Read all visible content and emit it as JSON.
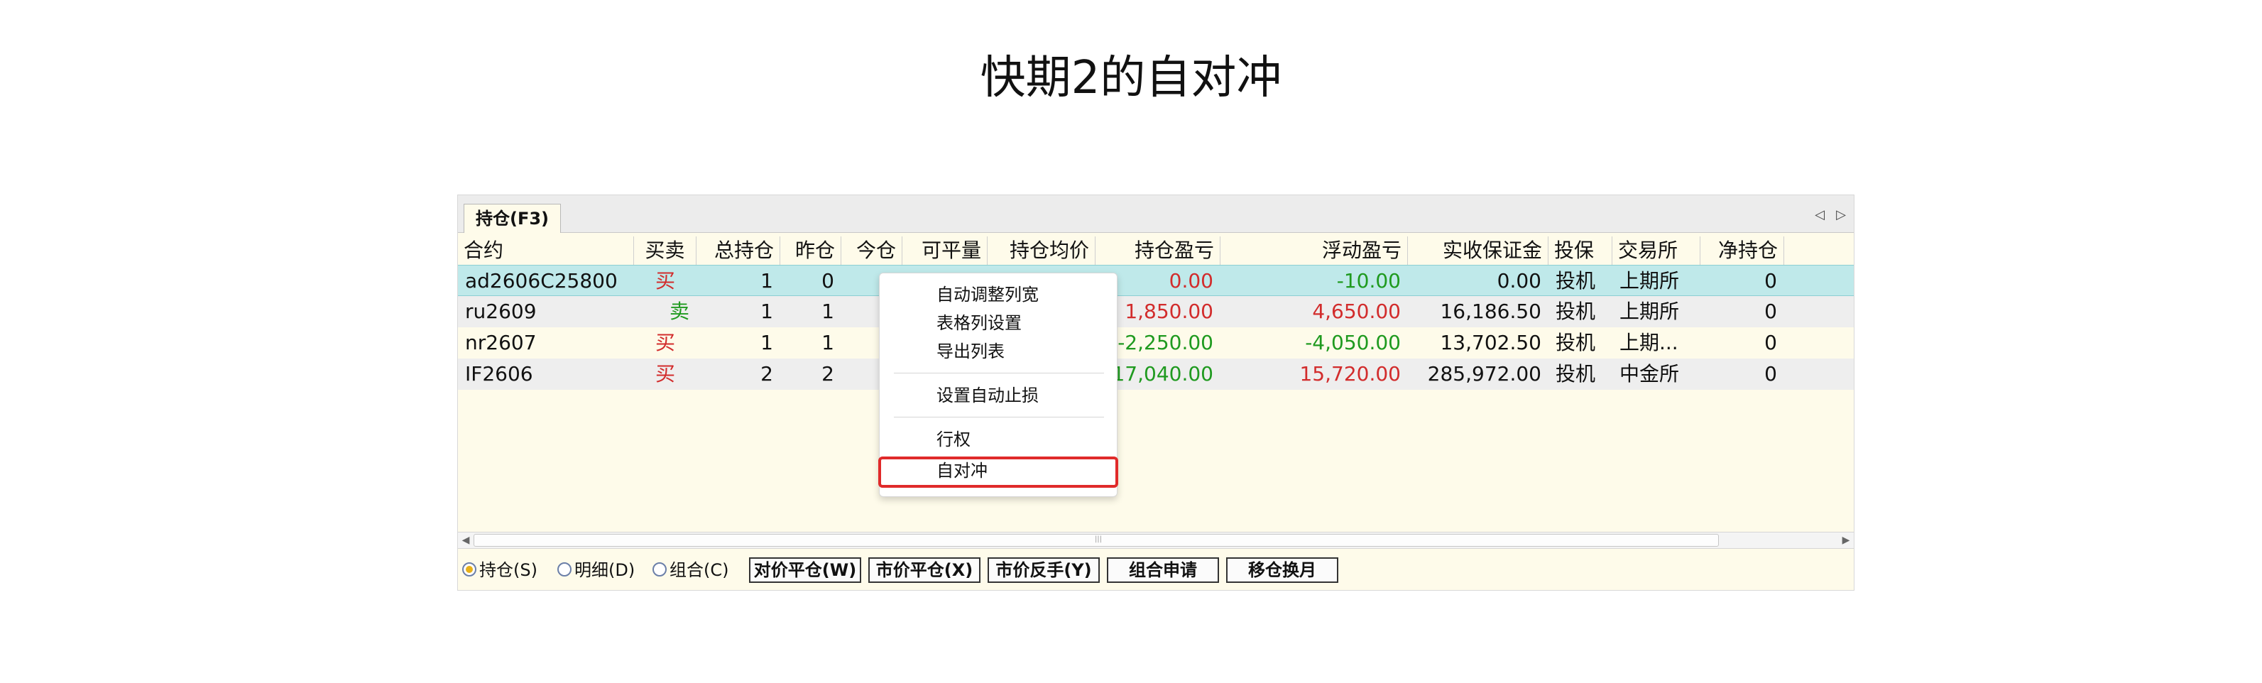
{
  "page_title": "快期2的自对冲",
  "tab": {
    "label": "持仓(F3)"
  },
  "columns": [
    "合约",
    "买卖",
    "总持仓",
    "昨仓",
    "今仓",
    "可平量",
    "持仓均价",
    "持仓盈亏",
    "浮动盈亏",
    "实收保证金",
    "投保",
    "交易所",
    "净持仓"
  ],
  "rows": [
    {
      "contract": "ad2606C25800",
      "side": "买",
      "total": "1",
      "yesterday": "0",
      "today": "",
      "closable": "",
      "avg_price": "",
      "pos_pnl": "0.00",
      "float_pnl": "-10.00",
      "margin": "0.00",
      "hedge": "投机",
      "exchange": "上期所",
      "net": "0"
    },
    {
      "contract": "ru2609",
      "side": "卖",
      "total": "1",
      "yesterday": "1",
      "today": "",
      "closable": "",
      "avg_price": "",
      "pos_pnl": "1,850.00",
      "float_pnl": "4,650.00",
      "margin": "16,186.50",
      "hedge": "投机",
      "exchange": "上期所",
      "net": "0"
    },
    {
      "contract": "nr2607",
      "side": "买",
      "total": "1",
      "yesterday": "1",
      "today": "",
      "closable": "",
      "avg_price": "",
      "pos_pnl": "-2,250.00",
      "float_pnl": "-4,050.00",
      "margin": "13,702.50",
      "hedge": "投机",
      "exchange": "上期...",
      "net": "0"
    },
    {
      "contract": "IF2606",
      "side": "买",
      "total": "2",
      "yesterday": "2",
      "today": "",
      "closable": "",
      "avg_price": "",
      "pos_pnl": "17,040.00",
      "float_pnl": "15,720.00",
      "margin": "285,972.00",
      "hedge": "投机",
      "exchange": "中金所",
      "net": "0"
    }
  ],
  "context_menu": {
    "items": [
      "自动调整列宽",
      "表格列设置",
      "导出列表",
      "设置自动止损",
      "行权",
      "自对冲"
    ]
  },
  "bottom": {
    "radios": [
      "持仓(S)",
      "明细(D)",
      "组合(C)"
    ],
    "buttons": [
      "对价平仓(W)",
      "市价平仓(X)",
      "市价反手(Y)",
      "组合申请",
      "移仓换月"
    ]
  },
  "colors": {
    "accent": "#e02a2a",
    "buy": "#d22c2c",
    "sell": "#1f9a1f",
    "selected_row": "#bfe9ea"
  }
}
